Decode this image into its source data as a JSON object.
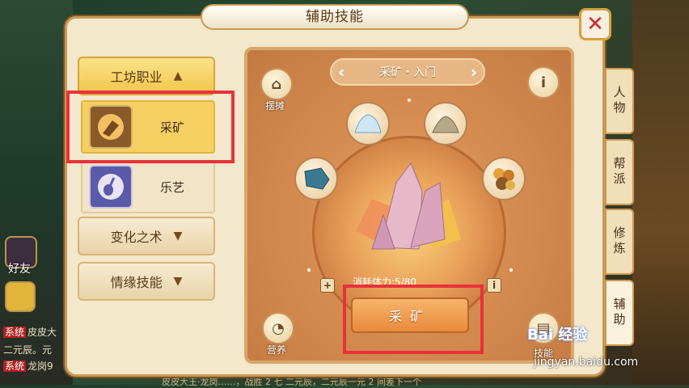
{
  "window": {
    "title": "辅助技能"
  },
  "left_panel": {
    "categories": [
      {
        "label": "工坊职业",
        "state": "expanded"
      },
      {
        "label": "变化之术",
        "state": "collapsed"
      },
      {
        "label": "情缘技能",
        "state": "collapsed"
      }
    ],
    "skills": [
      {
        "label": "采矿",
        "selected": true,
        "icon": "mining-icon"
      },
      {
        "label": "乐艺",
        "selected": false,
        "icon": "guitar-icon"
      }
    ]
  },
  "right_tabs": [
    "人物",
    "帮派",
    "修炼",
    "辅助"
  ],
  "skill_detail": {
    "name": "采矿・入门",
    "stall_label": "摆摊",
    "nourish_label": "营养",
    "cost_text": "消耗体力:5/80",
    "action_label": "采矿",
    "ores": [
      "snow-ore-icon",
      "grain-ore-icon",
      "blue-ore-icon",
      "gold-ore-icon"
    ],
    "skill_tab_label": "技能"
  },
  "hud": {
    "friend_label": "好友",
    "chat_lines": [
      {
        "tag": "系统",
        "text": "皮皮大"
      },
      {
        "tag": "",
        "text": "二元辰。元"
      },
      {
        "tag": "系统",
        "text": "龙岗9"
      }
    ],
    "bottom_text": "皮皮大王·龙岗……，战胜 2 七 二元辰，二元辰一元 2 间差下一个"
  },
  "watermark": {
    "brand": "Bai 经验",
    "url": "jingyan.baidu.com"
  },
  "colors": {
    "accent": "#e8323a",
    "panel": "#f3e7cc",
    "gold": "#f6cf62"
  }
}
